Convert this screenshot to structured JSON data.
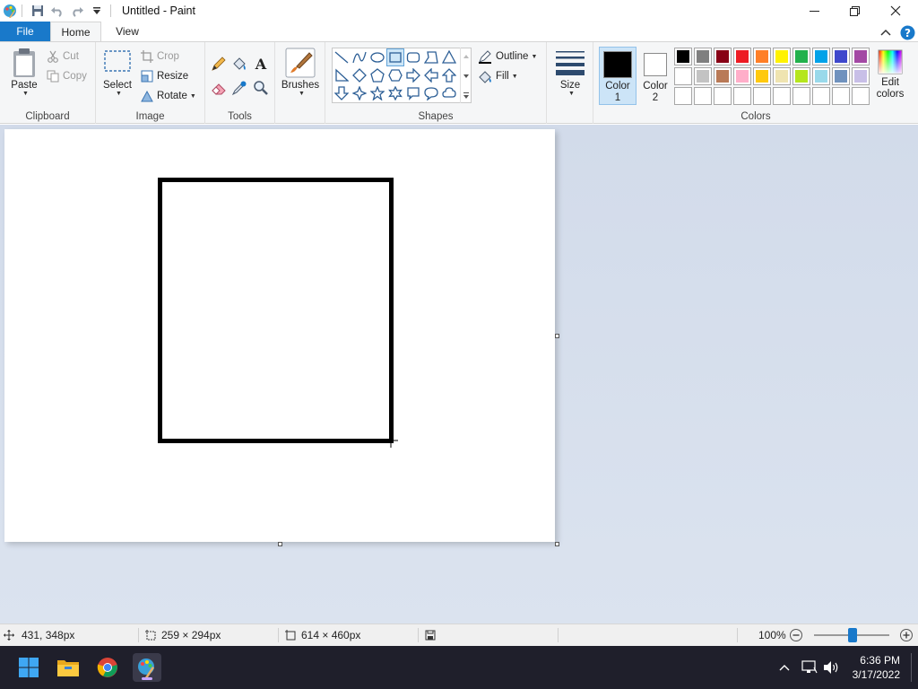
{
  "window": {
    "title": "Untitled - Paint",
    "minimize_label": "—",
    "maximize_label": "❐",
    "close_label": "✕"
  },
  "tabs": {
    "file": "File",
    "home": "Home",
    "view": "View"
  },
  "clipboard": {
    "paste": "Paste",
    "cut": "Cut",
    "copy": "Copy",
    "label": "Clipboard"
  },
  "image": {
    "select": "Select",
    "crop": "Crop",
    "resize": "Resize",
    "rotate": "Rotate",
    "label": "Image"
  },
  "tools": {
    "label": "Tools",
    "brushes": "Brushes"
  },
  "shapes": {
    "outline": "Outline",
    "fill": "Fill",
    "label": "Shapes"
  },
  "size": {
    "label": "Size"
  },
  "colors": {
    "color1_line1": "Color",
    "color1_line2": "1",
    "color2_line1": "Color",
    "color2_line2": "2",
    "edit_line1": "Edit",
    "edit_line2": "colors",
    "label": "Colors",
    "color1": "#000000",
    "color2": "#ffffff",
    "palette_row1": [
      "#000000",
      "#7f7f7f",
      "#880015",
      "#ed1c24",
      "#ff7f27",
      "#fff200",
      "#22b14c",
      "#00a2e8",
      "#3f48cc",
      "#a349a4"
    ],
    "palette_row2": [
      "#ffffff",
      "#c3c3c3",
      "#b97a57",
      "#ffaec9",
      "#ffc90e",
      "#efe4b0",
      "#b5e61d",
      "#99d9ea",
      "#7092be",
      "#c8bfe7"
    ]
  },
  "status": {
    "cursor_pos": "431, 348px",
    "selection_size": "259 × 294px",
    "canvas_size": "614 × 460px",
    "zoom": "100%",
    "zoom_level": 0.5
  },
  "taskbar": {
    "time": "6:36 PM",
    "date": "3/17/2022"
  }
}
